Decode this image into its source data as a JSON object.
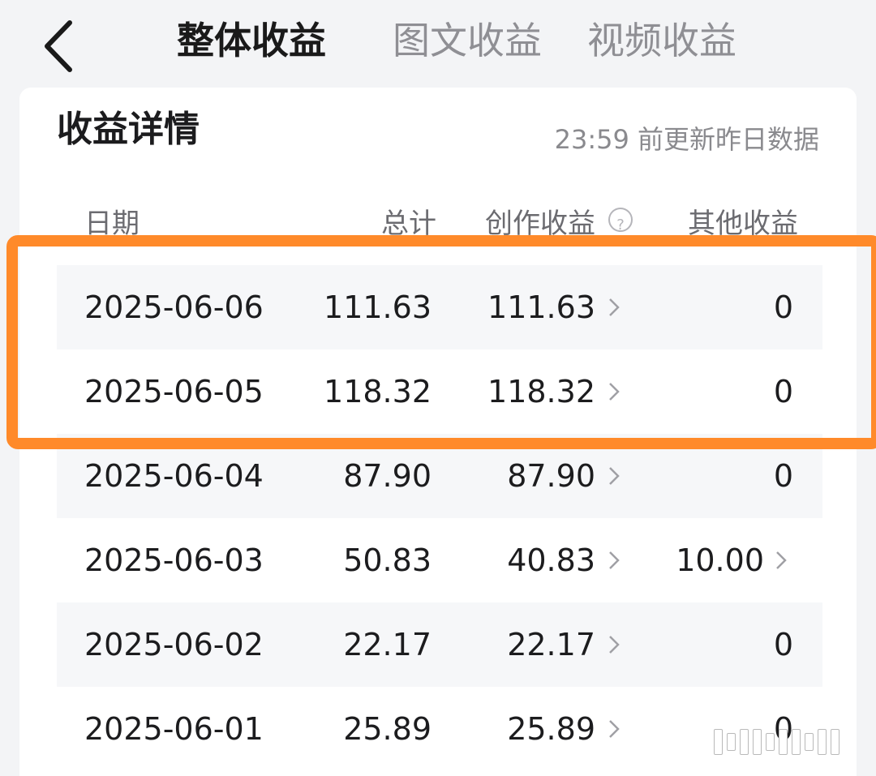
{
  "header": {
    "tabs": [
      {
        "label": "整体收益",
        "active": true
      },
      {
        "label": "图文收益",
        "active": false
      },
      {
        "label": "视频收益",
        "active": false
      }
    ]
  },
  "card": {
    "title": "收益详情",
    "update_note": "23:59 前更新昨日数据"
  },
  "table": {
    "columns": [
      "日期",
      "总计",
      "创作收益",
      "其他收益"
    ],
    "rows": [
      {
        "date": "2025-06-06",
        "total": "111.63",
        "creation": "111.63",
        "other": "0"
      },
      {
        "date": "2025-06-05",
        "total": "118.32",
        "creation": "118.32",
        "other": "0"
      },
      {
        "date": "2025-06-04",
        "total": "87.90",
        "creation": "87.90",
        "other": "0"
      },
      {
        "date": "2025-06-03",
        "total": "50.83",
        "creation": "40.83",
        "other": "10.00"
      },
      {
        "date": "2025-06-02",
        "total": "22.17",
        "creation": "22.17",
        "other": "0"
      },
      {
        "date": "2025-06-01",
        "total": "25.89",
        "creation": "25.89",
        "other": "0"
      }
    ]
  },
  "highlight_color": "#ff8a2a",
  "icons": {
    "back": "chevron-left-icon",
    "help": "question-circle-icon",
    "row_arrow": "chevron-right-icon"
  }
}
